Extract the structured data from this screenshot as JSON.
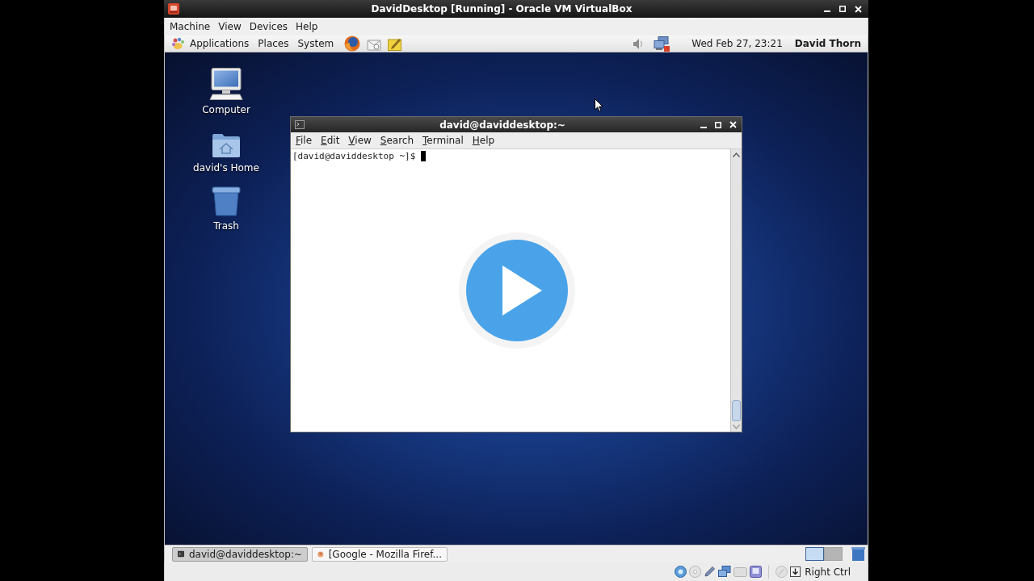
{
  "host_window": {
    "title": "DavidDesktop [Running] - Oracle VM VirtualBox",
    "menu": [
      "Machine",
      "View",
      "Devices",
      "Help"
    ]
  },
  "guest_top_panel": {
    "menus": [
      "Applications",
      "Places",
      "System"
    ],
    "clock": "Wed Feb 27, 23:21",
    "user": "David Thorn"
  },
  "desktop_icons": [
    {
      "label": "Computer",
      "kind": "computer"
    },
    {
      "label": "david's Home",
      "kind": "home"
    },
    {
      "label": "Trash",
      "kind": "trash"
    }
  ],
  "terminal": {
    "title": "david@daviddesktop:~",
    "menu": [
      "File",
      "Edit",
      "View",
      "Search",
      "Terminal",
      "Help"
    ],
    "prompt": "[david@daviddesktop ~]$"
  },
  "taskbar": [
    {
      "label": "david@daviddesktop:~",
      "kind": "terminal",
      "selected": true
    },
    {
      "label": "[Google - Mozilla Firef...",
      "kind": "browser",
      "selected": false
    }
  ],
  "workspaces": [
    {
      "selected": true
    },
    {
      "selected": false
    }
  ],
  "status_bar": {
    "host_key": "Right Ctrl"
  }
}
